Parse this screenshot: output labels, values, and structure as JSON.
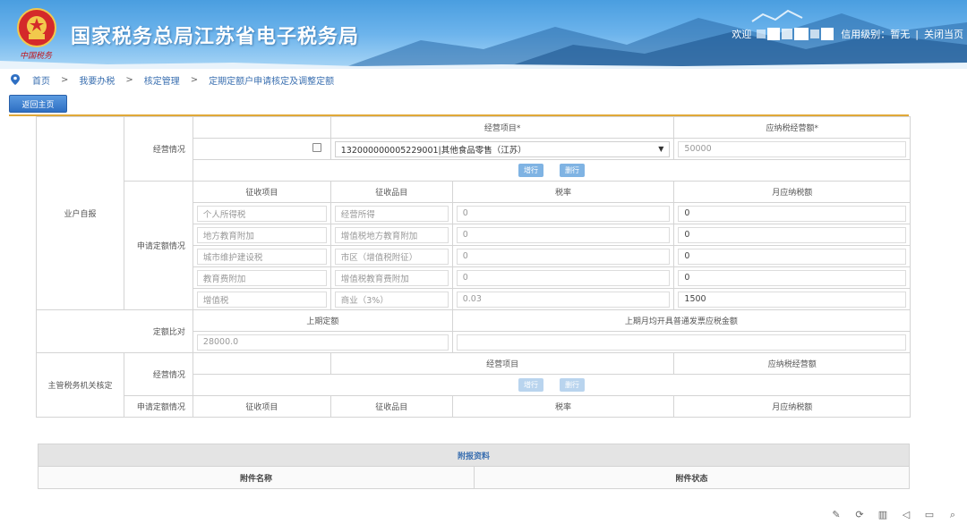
{
  "header": {
    "emblem_text": "中国税务",
    "site_title": "国家税务总局江苏省电子税务局",
    "welcome": "欢迎",
    "credit_level": "信用级别：暂无",
    "separator": "|",
    "close_page": "关闭当页"
  },
  "breadcrumb": {
    "items": [
      "首页",
      "我要办税",
      "核定管理",
      "定期定额户申请核定及调整定额"
    ],
    "arrow": ">"
  },
  "back_button": "返回主页",
  "form": {
    "self_report_label": "业户自报",
    "business_info_label": "经营情况",
    "business_item_header": "经营项目*",
    "taxable_turnover_header": "应纳税经营额*",
    "business_item_value": "132000000005229001|其他食品零售（江苏）",
    "taxable_turnover_value": "50000",
    "add_row": "增行",
    "delete_row": "删行",
    "quota_apply_label": "申请定额情况",
    "col_levy_item": "征收项目",
    "col_levy_category": "征收品目",
    "col_tax_rate": "税率",
    "col_monthly_tax": "月应纳税额",
    "rows": [
      {
        "item": "个人所得税",
        "category": "经营所得",
        "rate": "0",
        "tax": "0"
      },
      {
        "item": "地方教育附加",
        "category": "增值税地方教育附加",
        "rate": "0",
        "tax": "0"
      },
      {
        "item": "城市维护建设税",
        "category": "市区（增值税附征）",
        "rate": "0",
        "tax": "0"
      },
      {
        "item": "教育费附加",
        "category": "增值税教育费附加",
        "rate": "0",
        "tax": "0"
      },
      {
        "item": "增值税",
        "category": "商业（3%）",
        "rate": "0.03",
        "tax": "1500"
      }
    ],
    "quota_compare_label": "定额比对",
    "prev_quota_header": "上期定额",
    "prev_invoice_header": "上期月均开具普通发票应税金额",
    "prev_quota_value": "28000.0",
    "prev_invoice_value": "",
    "authority_label": "主管税务机关核定",
    "auth_business_item_header": "经营项目",
    "auth_turnover_header": "应纳税经营额"
  },
  "attachments": {
    "title": "附报资料",
    "col_name": "附件名称",
    "col_status": "附件状态"
  },
  "colors": {
    "header_blue": "#4a9ee0",
    "link_blue": "#3a6fb0",
    "button_blue": "#2e6fc3",
    "accent_orange": "#e0a838"
  }
}
